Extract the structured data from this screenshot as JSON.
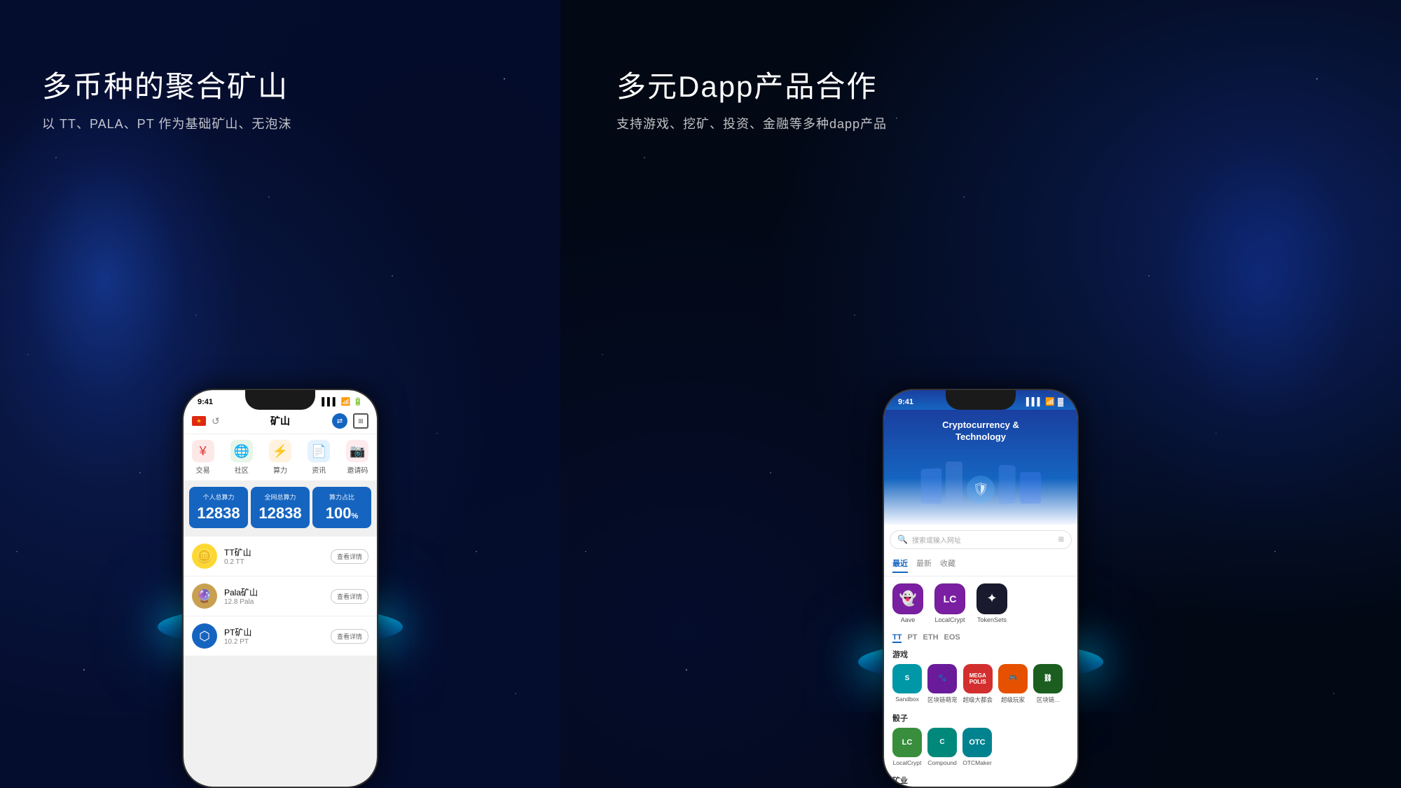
{
  "left": {
    "heading_main": "多币种的聚合矿山",
    "heading_sub": "以 TT、PALA、PT 作为基础矿山、无泡沫",
    "status_time": "9:41",
    "nav_title": "矿山",
    "quick_nav": [
      {
        "icon": "¥",
        "label": "交易",
        "color": "#E53935"
      },
      {
        "icon": "🌐",
        "label": "社区",
        "color": "#43A047"
      },
      {
        "icon": "⚡",
        "label": "算力",
        "color": "#FB8C00"
      },
      {
        "icon": "📄",
        "label": "资讯",
        "color": "#1565C0"
      },
      {
        "icon": "📷",
        "label": "邀请码",
        "color": "#E53935"
      }
    ],
    "stats": [
      {
        "label": "个人总算力",
        "value": "12838",
        "unit": ""
      },
      {
        "label": "全网总算力",
        "value": "12838",
        "unit": ""
      },
      {
        "label": "算力占比",
        "value": "100",
        "unit": "%"
      }
    ],
    "mines": [
      {
        "name": "TT矿山",
        "amount": "0.2 TT",
        "btn": "查看详情",
        "color": "#FDD835",
        "emoji": "🪙"
      },
      {
        "name": "Pala矿山",
        "amount": "12.8 Pala",
        "btn": "查看详情",
        "color": "#C8A050",
        "emoji": "🔮"
      },
      {
        "name": "PT矿山",
        "amount": "10.2 PT",
        "btn": "查看详情",
        "color": "#1565C0",
        "emoji": "⬡"
      }
    ]
  },
  "right": {
    "heading_main": "多元Dapp产品合作",
    "heading_sub": "支持游戏、挖矿、投资、金融等多种dapp产品",
    "status_time": "9:41",
    "app_title_line1": "Cryptocurrency &",
    "app_title_line2": "Technology",
    "search_placeholder": "搜索或输入网址",
    "tabs": [
      {
        "label": "最近",
        "active": true
      },
      {
        "label": "最新",
        "active": false
      },
      {
        "label": "收藏",
        "active": false
      }
    ],
    "featured_dapps": [
      {
        "label": "Aave",
        "color": "#7B1FA2"
      },
      {
        "label": "LocalCrypt",
        "color": "#7B1FA2"
      },
      {
        "label": "TokenSets",
        "color": "#1a1a2e"
      }
    ],
    "chain_tabs": [
      {
        "label": "TT",
        "active": true
      },
      {
        "label": "PT",
        "active": false
      },
      {
        "label": "ETH",
        "active": false
      },
      {
        "label": "EOS",
        "active": false
      }
    ],
    "sections": [
      {
        "title": "游戏",
        "apps": [
          {
            "label": "Sandbox",
            "color": "#0097A7"
          },
          {
            "label": "区块链萌宠",
            "color": "#6A1B9A"
          },
          {
            "label": "超级大都会",
            "color": "#D32F2F"
          },
          {
            "label": "超级玩家",
            "color": "#E65100"
          },
          {
            "label": "区块链...",
            "color": "#1B5E20"
          }
        ]
      },
      {
        "title": "骰子",
        "apps": [
          {
            "label": "LocalCrypt",
            "color": "#388E3C"
          },
          {
            "label": "Compound",
            "color": "#00897B"
          },
          {
            "label": "OTCMaker",
            "color": "#00838F"
          }
        ]
      },
      {
        "title": "矿业",
        "apps": []
      }
    ]
  }
}
